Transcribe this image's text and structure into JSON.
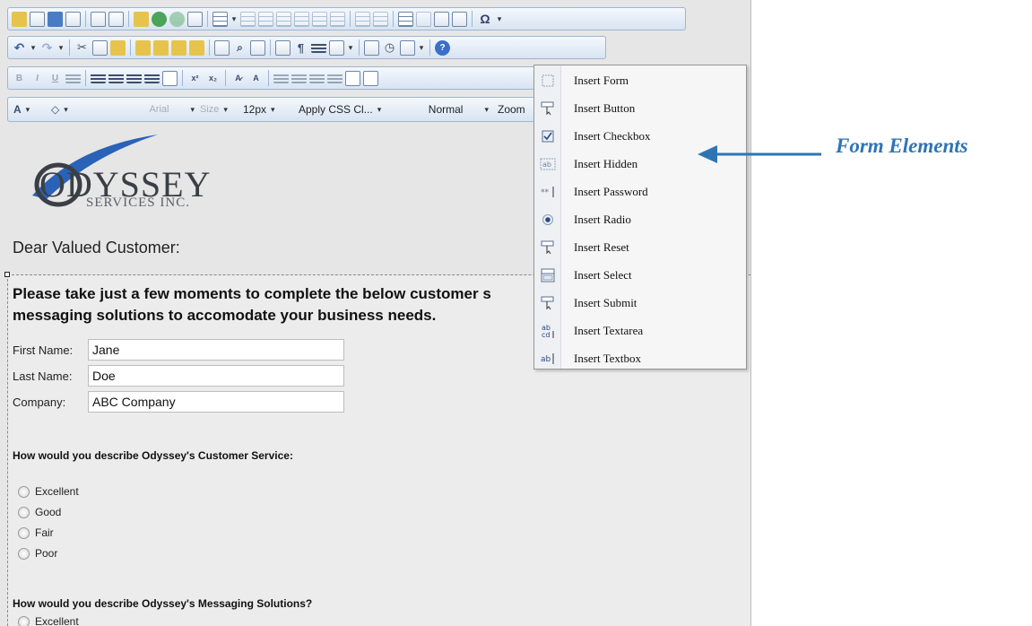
{
  "toolbar4": {
    "font_color_label": "A",
    "font_name": "Arial",
    "size_label": "Size",
    "font_size": "12px",
    "css_class": "Apply CSS Cl...",
    "paragraph": "Normal",
    "zoom": "Zoom"
  },
  "toolbar1_special": {
    "omega": "Ω"
  },
  "toolbar3": {
    "bold": "B",
    "italic": "I",
    "underline": "U"
  },
  "logo": {
    "name": "ODYSSEY",
    "sub": "SERVICES INC."
  },
  "document": {
    "greeting": "Dear Valued Customer:",
    "intro": "Please take just a few moments to complete the below customer s",
    "intro2": "messaging solutions to accomodate your business needs.",
    "first_name_label": "First Name:",
    "first_name_value": "Jane",
    "last_name_label": "Last Name:",
    "last_name_value": "Doe",
    "company_label": "Company:",
    "company_value": "ABC Company",
    "question1": "How would you describe Odyssey's Customer Service:",
    "options1": [
      "Excellent",
      "Good",
      "Fair",
      "Poor"
    ],
    "question2": "How would you describe Odyssey's Messaging Solutions?",
    "options2": [
      "Excellent"
    ]
  },
  "menu": {
    "items": [
      {
        "label": "Insert Form",
        "icon": "form-icon"
      },
      {
        "label": "Insert Button",
        "icon": "button-icon"
      },
      {
        "label": "Insert Checkbox",
        "icon": "checkbox-icon"
      },
      {
        "label": "Insert Hidden",
        "icon": "hidden-field-icon"
      },
      {
        "label": "Insert Password",
        "icon": "password-icon"
      },
      {
        "label": "Insert Radio",
        "icon": "radio-icon"
      },
      {
        "label": "Insert Reset",
        "icon": "reset-icon"
      },
      {
        "label": "Insert Select",
        "icon": "select-icon"
      },
      {
        "label": "Insert Submit",
        "icon": "submit-icon"
      },
      {
        "label": "Insert Textarea",
        "icon": "textarea-icon"
      },
      {
        "label": "Insert Textbox",
        "icon": "textbox-icon"
      }
    ]
  },
  "annotation": {
    "text": "Form Elements",
    "color": "#2e74b5"
  },
  "colors": {
    "toolbar_border": "#9fb5d2",
    "accent": "#2e74b5"
  }
}
